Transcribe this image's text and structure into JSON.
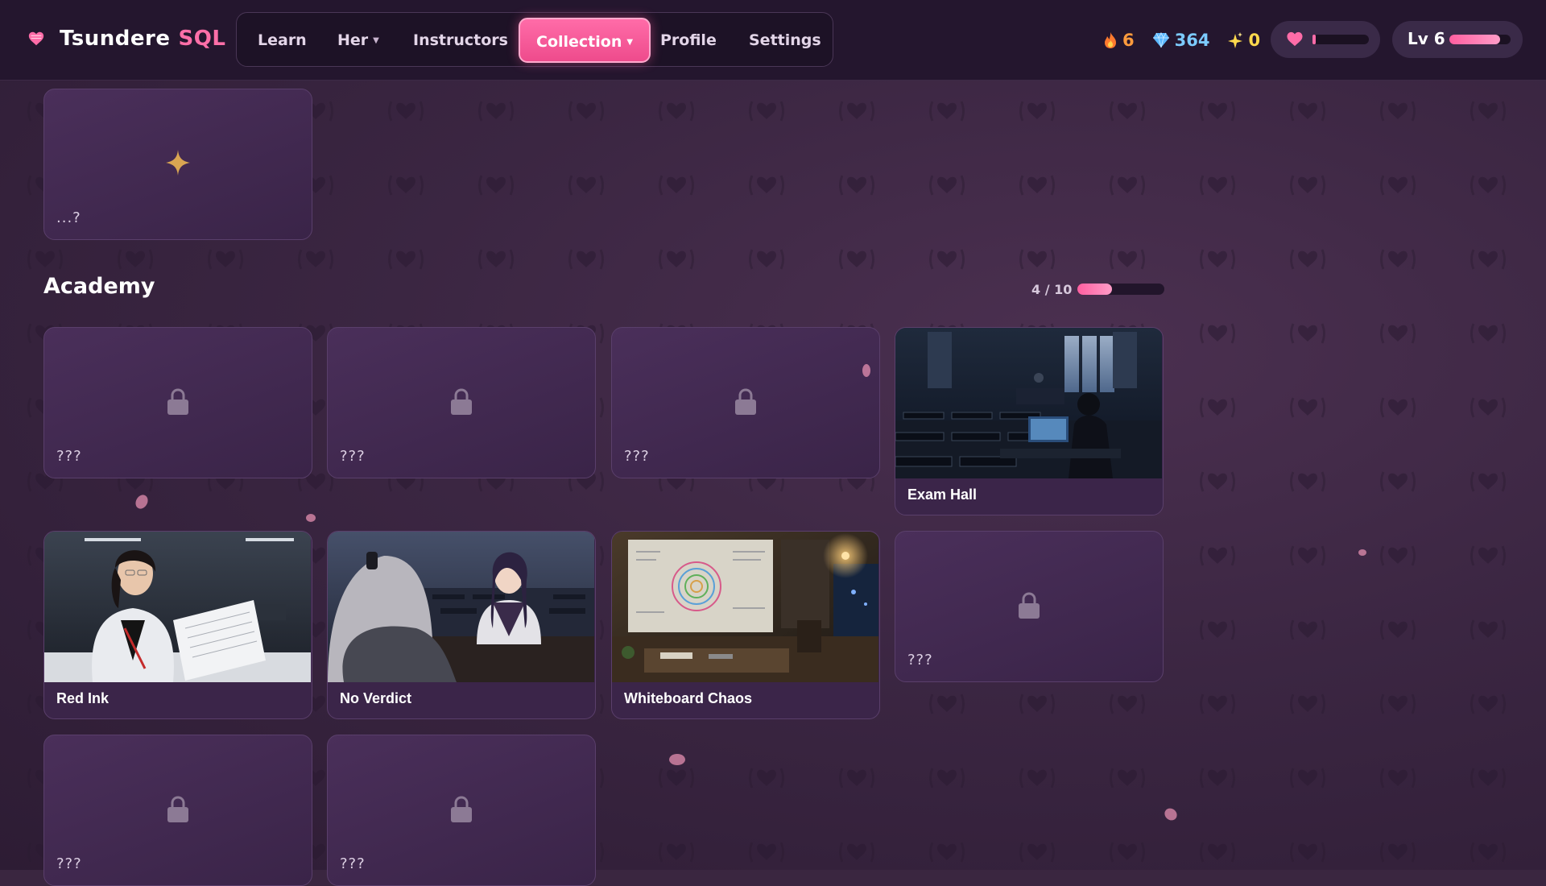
{
  "app": {
    "brand_primary": "Tsundere",
    "brand_secondary": "SQL",
    "accent": "#ff6ca8"
  },
  "nav": {
    "items": [
      {
        "label": "Learn",
        "dropdown": false,
        "active": false
      },
      {
        "label": "Her",
        "dropdown": true,
        "active": false
      },
      {
        "label": "Instructors",
        "dropdown": false,
        "active": false
      },
      {
        "label": "Collection",
        "dropdown": true,
        "active": true
      },
      {
        "label": "Profile",
        "dropdown": false,
        "active": false
      },
      {
        "label": "Settings",
        "dropdown": false,
        "active": false
      }
    ]
  },
  "stats": {
    "streak": {
      "icon": "flame-icon",
      "value": "6",
      "color": "#ff9b3d"
    },
    "gems": {
      "icon": "diamond-icon",
      "value": "364",
      "color": "#6fc6ff"
    },
    "sparkles": {
      "icon": "sparkle-icon",
      "value": "0",
      "color": "#ffd94d"
    }
  },
  "affection": {
    "icon": "heart-icon",
    "level": 0.05
  },
  "level": {
    "label": "Lv 6",
    "progress": 0.83
  },
  "top_section": {
    "cards": [
      {
        "state": "mystery",
        "icon": "sparkle-star-icon",
        "label": "...?"
      }
    ]
  },
  "academy": {
    "title": "Academy",
    "progress_text": "4 / 10",
    "progress": 0.4,
    "cards": [
      {
        "state": "locked",
        "label": "???"
      },
      {
        "state": "locked",
        "label": "???"
      },
      {
        "state": "locked",
        "label": "???"
      },
      {
        "state": "unlocked",
        "label": "Exam Hall",
        "scene": "exam-hall-image"
      },
      {
        "state": "unlocked",
        "label": "Red Ink",
        "scene": "red-ink-image"
      },
      {
        "state": "unlocked",
        "label": "No Verdict",
        "scene": "no-verdict-image"
      },
      {
        "state": "unlocked",
        "label": "Whiteboard Chaos",
        "scene": "whiteboard-chaos-image"
      },
      {
        "state": "locked",
        "label": "???"
      },
      {
        "state": "locked",
        "label": "???"
      },
      {
        "state": "locked",
        "label": "???"
      }
    ]
  }
}
